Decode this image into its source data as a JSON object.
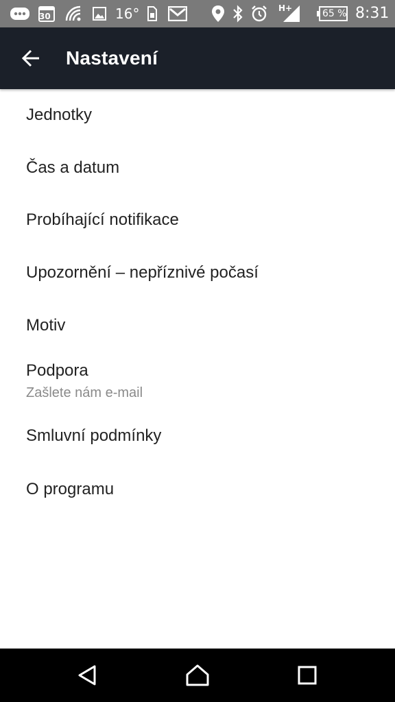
{
  "status_bar": {
    "calendar_day": "30",
    "temperature": "16°",
    "network_type": "H+",
    "battery": "65 %",
    "time": "8:31",
    "icons": [
      "chat-icon",
      "calendar-icon",
      "wifi-signal-icon",
      "gallery-icon",
      "weather-temperature",
      "sim-icon",
      "email-icon",
      "location-icon",
      "bluetooth-icon",
      "alarm-icon",
      "cell-signal-icon",
      "battery-icon"
    ]
  },
  "app_bar": {
    "title": "Nastavení",
    "back_icon": "arrow-left-icon",
    "background": "#1b2029"
  },
  "settings": {
    "items": [
      {
        "title": "Jednotky"
      },
      {
        "title": "Čas a datum"
      },
      {
        "title": "Probíhající notifikace"
      },
      {
        "title": "Upozornění – nepříznivé počasí"
      },
      {
        "title": "Motiv"
      },
      {
        "title": "Podpora",
        "subtitle": "Zašlete nám e-mail"
      },
      {
        "title": "Smluvní podmínky"
      },
      {
        "title": "O programu"
      }
    ]
  },
  "nav_bar": {
    "buttons": [
      "back-triangle-icon",
      "home-icon",
      "recents-square-icon"
    ]
  }
}
